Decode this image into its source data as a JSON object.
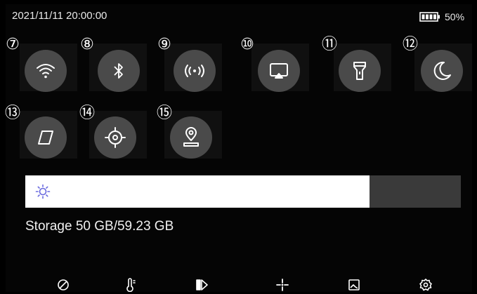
{
  "status": {
    "datetime": "2021/11/11 20:00:00",
    "battery_percent": "50%",
    "battery_level": 1.0
  },
  "toggles": [
    {
      "number": "⑦",
      "icon": "wifi-icon"
    },
    {
      "number": "⑧",
      "icon": "bluetooth-icon"
    },
    {
      "number": "⑨",
      "icon": "hotspot-icon"
    },
    {
      "number": "⑩",
      "icon": "screen-cast-icon"
    },
    {
      "number": "⑪",
      "icon": "flashlight-icon"
    },
    {
      "number": "⑫",
      "icon": "moon-icon"
    },
    {
      "number": "⑬",
      "icon": "compass-icon"
    },
    {
      "number": "⑭",
      "icon": "target-icon"
    },
    {
      "number": "⑮",
      "icon": "location-pin-icon"
    }
  ],
  "brightness": {
    "icon": "sun-icon",
    "level": 0.79
  },
  "storage": {
    "text": "Storage 50 GB/59.23 GB"
  },
  "bottom_bar": [
    {
      "icon": "disable-icon"
    },
    {
      "icon": "thermometer-icon"
    },
    {
      "icon": "palette-icon"
    },
    {
      "icon": "crosshair-icon"
    },
    {
      "icon": "image-icon"
    },
    {
      "icon": "gear-icon"
    }
  ],
  "colors": {
    "background": "#000000",
    "toggle_fill": "#4a4a4a",
    "slider_fill": "#ffffff",
    "slider_track": "#3a3a3a",
    "sun_icon": "#6a6adf"
  }
}
